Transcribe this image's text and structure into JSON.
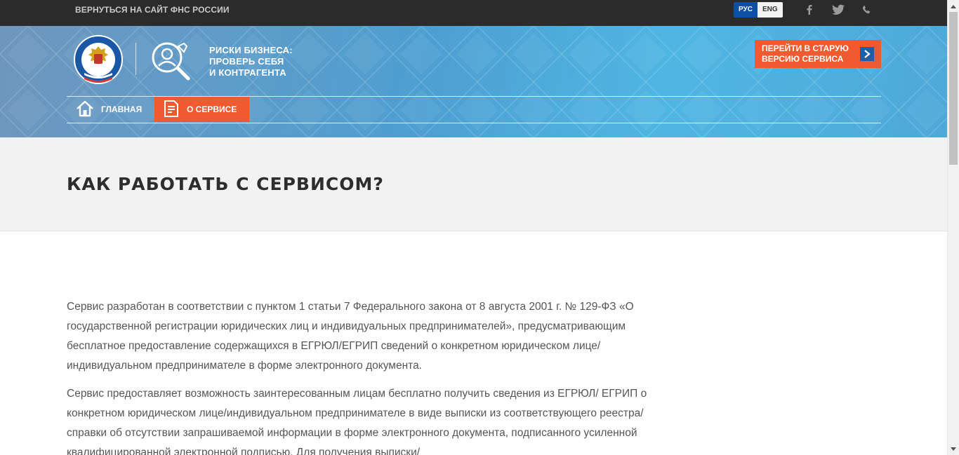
{
  "topbar": {
    "back_link": "ВЕРНУТЬСЯ НА САЙТ ФНС РОССИИ",
    "lang_ru": "РУС",
    "lang_en": "ENG",
    "social_icons": [
      "facebook-icon",
      "twitter-icon",
      "phone-icon"
    ]
  },
  "header": {
    "service_title_lines": [
      "РИСКИ БИЗНЕСА:",
      "ПРОВЕРЬ СЕБЯ",
      "И КОНТРАГЕНТА"
    ],
    "old_version_button": "ПЕРЕЙТИ В СТАРУЮ ВЕРСИЮ СЕРВИСА",
    "nav": {
      "home": "ГЛАВНАЯ",
      "about": "О СЕРВИСЕ"
    },
    "colors": {
      "accent": "#f05a30",
      "header_blue": "#4fa8d8",
      "topbar": "#2b2b2b"
    }
  },
  "main": {
    "title": "КАК РАБОТАТЬ С СЕРВИСОМ?",
    "paragraphs": [
      "Сервис разработан в соответствии с пунктом 1 статьи 7 Федерального закона от 8 августа 2001 г. № 129-ФЗ «О государственной регистрации юридических лиц и индивидуальных предпринимателей», предусматривающим бесплатное предоставление содержащихся в ЕГРЮЛ/ЕГРИП сведений о конкретном юридическом лице/индивидуальном предпринимателе в форме электронного документа.",
      "Сервис предоставляет возможность заинтересованным лицам бесплатно получить сведения из ЕГРЮЛ/ ЕГРИП о конкретном юридическом лице/индивидуальном предпринимателе в виде выписки из соответствующего реестра/справки об отсутствии запрашиваемой информации в форме электронного документа, подписанного усиленной квалифицированной электронной подписью. Для получения выписки/"
    ]
  }
}
